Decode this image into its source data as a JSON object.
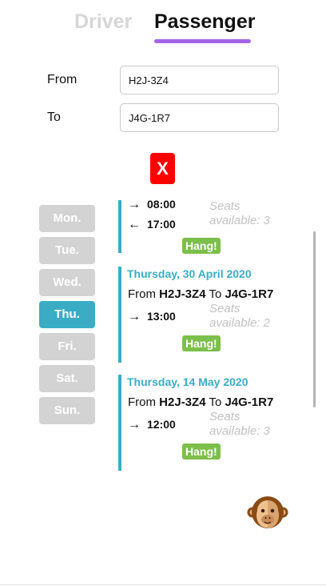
{
  "tabs": {
    "driver": "Driver",
    "passenger": "Passenger",
    "active": "passenger"
  },
  "form": {
    "from_label": "From",
    "from_value": "H2J-3Z4",
    "to_label": "To",
    "to_value": "J4G-1R7",
    "clear_label": "X"
  },
  "days": {
    "items": [
      "Mon.",
      "Tue.",
      "Wed.",
      "Thu.",
      "Fri.",
      "Sat.",
      "Sun."
    ],
    "selected": "Thu."
  },
  "rides": [
    {
      "times": [
        {
          "arrow": "→",
          "time": "08:00"
        },
        {
          "arrow": "←",
          "time": "17:00"
        }
      ],
      "seats": "Seats available: 3",
      "action": "Hang!"
    },
    {
      "date": "Thursday, 30 April 2020",
      "from_word": "From",
      "from": "H2J-3Z4",
      "to_word": "To",
      "to": "J4G-1R7",
      "times": [
        {
          "arrow": "→",
          "time": "13:00"
        }
      ],
      "seats": "Seats available: 2",
      "action": "Hang!"
    },
    {
      "date": "Thursday, 14 May 2020",
      "from_word": "From",
      "from": "H2J-3Z4",
      "to_word": "To",
      "to": "J4G-1R7",
      "times": [
        {
          "arrow": "→",
          "time": "12:00"
        }
      ],
      "seats": "Seats available: 3",
      "action": "Hang!"
    }
  ],
  "avatar": {
    "icon": "monkey-face-icon"
  },
  "colors": {
    "accent": "#3aadc5",
    "tab_underline": "#a565e8",
    "hang": "#7cbf4a",
    "clear": "#ff0000",
    "inactive_day": "#d3d3d3"
  }
}
